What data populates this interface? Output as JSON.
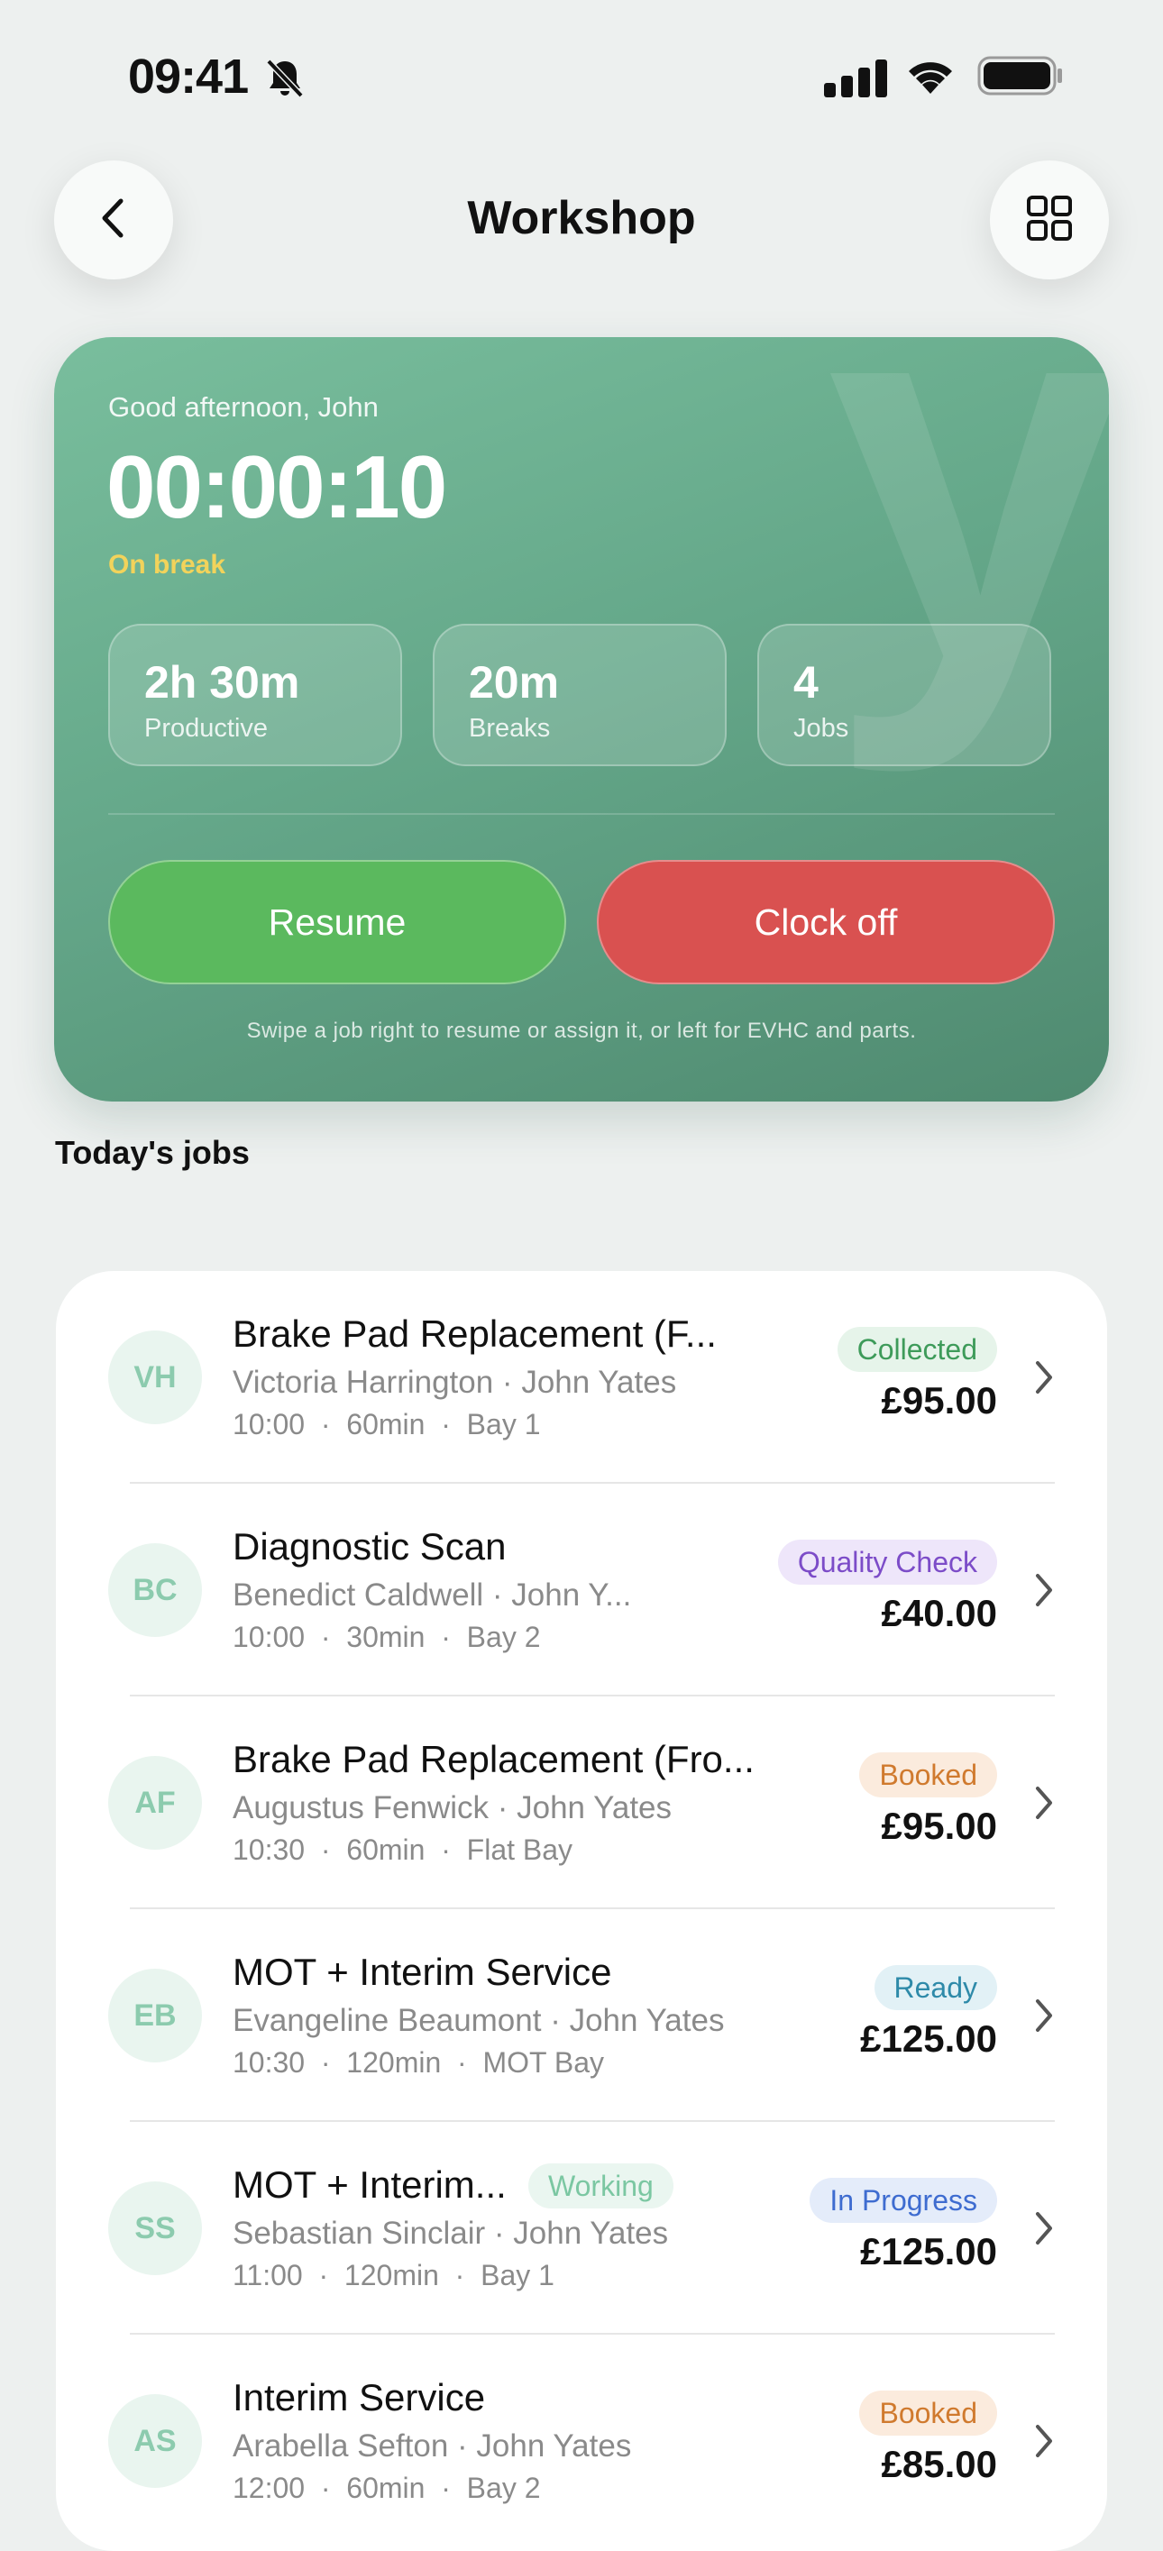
{
  "status_bar": {
    "time": "09:41"
  },
  "header": {
    "title": "Workshop"
  },
  "hero": {
    "watermark": "y",
    "greeting": "Good afternoon, John",
    "timer": "00:00:10",
    "status": "On break",
    "stats": [
      {
        "value": "2h 30m",
        "label": "Productive"
      },
      {
        "value": "20m",
        "label": "Breaks"
      },
      {
        "value": "4",
        "label": "Jobs"
      }
    ],
    "resume_label": "Resume",
    "clock_off_label": "Clock off",
    "hint": "Swipe a job right to resume or assign it, or left for EVHC and parts."
  },
  "section_title": "Today's jobs",
  "jobs": [
    {
      "initials": "VH",
      "title": "Brake Pad Replacement (F...",
      "customer": "Victoria Harrington · John Yates",
      "time": "10:00",
      "duration": "60min",
      "bay": "Bay 1",
      "status": "Collected",
      "price": "£95.00"
    },
    {
      "initials": "BC",
      "title": "Diagnostic Scan",
      "customer": "Benedict Caldwell · John Y...",
      "time": "10:00",
      "duration": "30min",
      "bay": "Bay 2",
      "status": "Quality Check",
      "price": "£40.00"
    },
    {
      "initials": "AF",
      "title": "Brake Pad Replacement (Fro...",
      "customer": "Augustus Fenwick · John Yates",
      "time": "10:30",
      "duration": "60min",
      "bay": "Flat Bay",
      "status": "Booked",
      "price": "£95.00"
    },
    {
      "initials": "EB",
      "title": "MOT + Interim Service",
      "customer": "Evangeline Beaumont · John Yates",
      "time": "10:30",
      "duration": "120min",
      "bay": "MOT Bay",
      "status": "Ready",
      "price": "£125.00"
    },
    {
      "initials": "SS",
      "title": "MOT + Interim...",
      "tag": "Working",
      "customer": "Sebastian Sinclair · John Yates",
      "time": "11:00",
      "duration": "120min",
      "bay": "Bay 1",
      "status": "In Progress",
      "price": "£125.00"
    },
    {
      "initials": "AS",
      "title": "Interim Service",
      "customer": "Arabella Sefton · John Yates",
      "time": "12:00",
      "duration": "60min",
      "bay": "Bay 2",
      "status": "Booked",
      "price": "£85.00"
    }
  ],
  "colors": {
    "accent_green": "#5BB95E",
    "danger_red": "#D95150",
    "break_yellow": "#F2D35B"
  }
}
